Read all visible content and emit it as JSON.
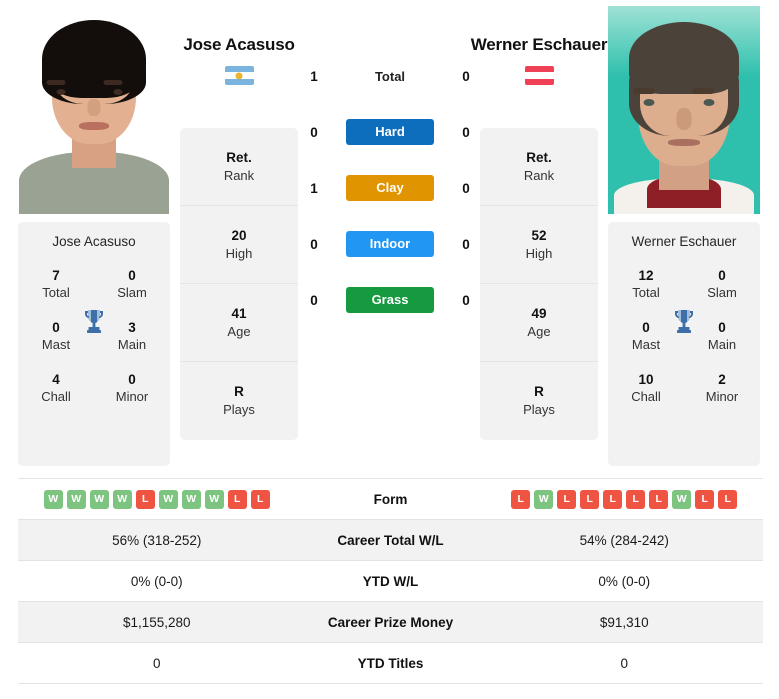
{
  "players": {
    "left": {
      "name": "Jose Acasuso",
      "flag": "argentina-flag",
      "card_name": "Jose Acasuso",
      "titles": [
        {
          "value": "7",
          "label": "Total"
        },
        {
          "value": "0",
          "label": "Slam"
        },
        {
          "value": "0",
          "label": "Mast"
        },
        {
          "value": "3",
          "label": "Main"
        },
        {
          "value": "4",
          "label": "Chall"
        },
        {
          "value": "0",
          "label": "Minor"
        }
      ],
      "ranks": [
        {
          "value": "Ret.",
          "label": "Rank"
        },
        {
          "value": "20",
          "label": "High"
        },
        {
          "value": "41",
          "label": "Age"
        },
        {
          "value": "R",
          "label": "Plays"
        }
      ],
      "form": [
        "W",
        "W",
        "W",
        "W",
        "L",
        "W",
        "W",
        "W",
        "L",
        "L"
      ],
      "career_total_wl": "56% (318-252)",
      "ytd_wl": "0% (0-0)",
      "career_prize_money": "$1,155,280",
      "ytd_titles": "0"
    },
    "right": {
      "name": "Werner Eschauer",
      "flag": "austria-flag",
      "card_name": "Werner Eschauer",
      "titles": [
        {
          "value": "12",
          "label": "Total"
        },
        {
          "value": "0",
          "label": "Slam"
        },
        {
          "value": "0",
          "label": "Mast"
        },
        {
          "value": "0",
          "label": "Main"
        },
        {
          "value": "10",
          "label": "Chall"
        },
        {
          "value": "2",
          "label": "Minor"
        }
      ],
      "ranks": [
        {
          "value": "Ret.",
          "label": "Rank"
        },
        {
          "value": "52",
          "label": "High"
        },
        {
          "value": "49",
          "label": "Age"
        },
        {
          "value": "R",
          "label": "Plays"
        }
      ],
      "form": [
        "L",
        "W",
        "L",
        "L",
        "L",
        "L",
        "L",
        "W",
        "L",
        "L"
      ],
      "career_total_wl": "54% (284-242)",
      "ytd_wl": "0% (0-0)",
      "career_prize_money": "$91,310",
      "ytd_titles": "0"
    }
  },
  "head_to_head": [
    {
      "surface": "Total",
      "left": "1",
      "right": "0",
      "color": null,
      "style": "plain"
    },
    {
      "surface": "Hard",
      "left": "0",
      "right": "0",
      "color": "#0d6ebd",
      "style": "pill"
    },
    {
      "surface": "Clay",
      "left": "1",
      "right": "0",
      "color": "#e09400",
      "style": "pill"
    },
    {
      "surface": "Indoor",
      "left": "0",
      "right": "0",
      "color": "#2196f3",
      "style": "pill"
    },
    {
      "surface": "Grass",
      "left": "0",
      "right": "0",
      "color": "#159a3f",
      "style": "pill"
    }
  ],
  "table_rows": [
    {
      "label": "Form",
      "key": "form",
      "type": "badges",
      "alt": false
    },
    {
      "label": "Career Total W/L",
      "key": "career_total_wl",
      "type": "text",
      "alt": true
    },
    {
      "label": "YTD W/L",
      "key": "ytd_wl",
      "type": "text",
      "alt": false
    },
    {
      "label": "Career Prize Money",
      "key": "career_prize_money",
      "type": "text",
      "alt": true
    },
    {
      "label": "YTD Titles",
      "key": "ytd_titles",
      "type": "text",
      "alt": false
    }
  ],
  "colors": {
    "hard": "#0d6ebd",
    "clay": "#e09400",
    "indoor": "#2196f3",
    "grass": "#159a3f",
    "win": "#7cc47f",
    "loss": "#ef5341",
    "card_bg": "#f2f2f2",
    "trophy": "#3d6fa8"
  }
}
